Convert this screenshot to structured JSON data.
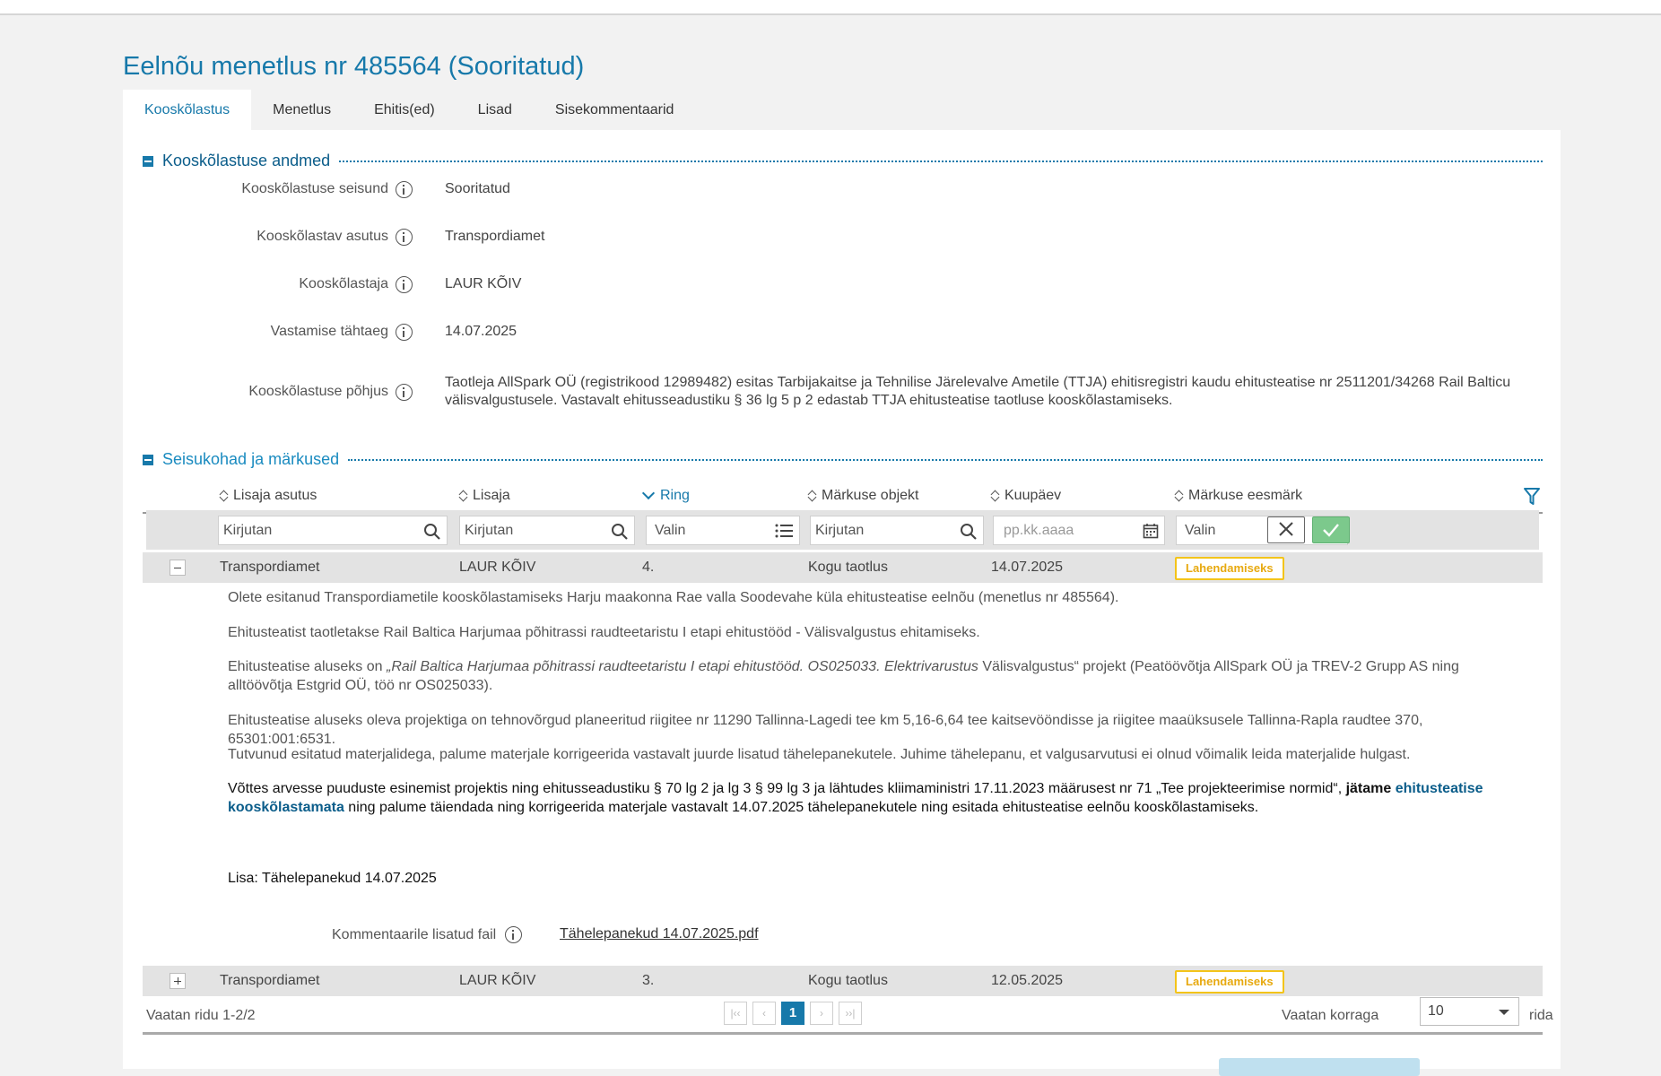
{
  "page": {
    "title": "Eelnõu menetlus nr 485564 (Sooritatud)"
  },
  "tabs": [
    {
      "label": "Kooskõlastus"
    },
    {
      "label": "Menetlus"
    },
    {
      "label": "Ehitis(ed)"
    },
    {
      "label": "Lisad"
    },
    {
      "label": "Sisekommentaarid"
    }
  ],
  "approval_section": {
    "title": "Kooskõlastuse andmed",
    "fields": [
      {
        "label": "Kooskõlastuse seisund",
        "value": "Sooritatud"
      },
      {
        "label": "Kooskõlastav asutus",
        "value": "Transpordiamet"
      },
      {
        "label": "Kooskõlastaja",
        "value": "LAUR KÕIV"
      },
      {
        "label": "Vastamise tähtaeg",
        "value": "14.07.2025"
      },
      {
        "label": "Kooskõlastuse põhjus",
        "value": "Taotleja AllSpark OÜ (registrikood 12989482) esitas Tarbijakaitse ja Tehnilise Järelevalve Ametile (TTJA) ehitisregistri kaudu ehitusteatise nr 2511201/34268 Rail Balticu välisvalgustusele. Vastavalt ehitusseadustiku § 36 lg 5 p 2 edastab TTJA ehitusteatise taotluse kooskõlastamiseks."
      }
    ]
  },
  "remarks_section": {
    "title": "Seisukohad ja märkused",
    "columns": [
      {
        "label": "Lisaja asutus"
      },
      {
        "label": "Lisaja"
      },
      {
        "label": "Ring"
      },
      {
        "label": "Märkuse objekt"
      },
      {
        "label": "Kuupäev"
      },
      {
        "label": "Märkuse eesmärk"
      }
    ],
    "filters": {
      "agency_placeholder": "Kirjutan",
      "author_placeholder": "Kirjutan",
      "round_placeholder": "Valin",
      "object_placeholder": "Kirjutan",
      "date_placeholder": "pp.kk.aaaa",
      "purpose_placeholder": "Valin"
    },
    "rows": [
      {
        "agency": "Transpordiamet",
        "author": "LAUR KÕIV",
        "round": "4.",
        "object": "Kogu taotlus",
        "date": "14.07.2025",
        "purpose": "Lahendamiseks"
      },
      {
        "agency": "Transpordiamet",
        "author": "LAUR KÕIV",
        "round": "3.",
        "object": "Kogu taotlus",
        "date": "12.05.2025",
        "purpose": "Lahendamiseks"
      }
    ],
    "detail": {
      "p1": "Olete esitanud Transpordiametile kooskõlastamiseks Harju maakonna Rae valla Soodevahe küla ehitusteatise eelnõu (menetlus nr 485564).",
      "p2": "Ehitusteatist taotletakse Rail Baltica Harjumaa põhitrassi raudteetaristu I etapi ehitustööd - Välisvalgustus ehitamiseks.",
      "p3_a": "Ehitusteatise aluseks on ",
      "p3_italic": "„Rail Baltica Harjumaa põhitrassi raudteetaristu I etapi ehitustööd. OS025033. Elektrivarustus",
      "p3_b": " Välisvalgustus“ projekt (Peatöövõtja AllSpark OÜ ja TREV-2 Grupp AS ning alltöövõtja Estgrid OÜ, töö nr OS025033).",
      "p4": "Ehitusteatise aluseks oleva projektiga on tehnovõrgud planeeritud riigitee nr 11290  Tallinna-Lagedi tee km 5,16-6,64 tee kaitsevööndisse ja riigitee maaüksusele Tallinna-Rapla raudtee 370, 65301:001:6531.",
      "p5": "Tutvunud esitatud materjalidega, palume materjale korrigeerida vastavalt juurde lisatud tähelepanekutele. Juhime tähelepanu, et valgusarvutusi ei olnud võimalik leida materjalide hulgast.",
      "p6_a": "Võttes arvesse puuduste esinemist projektis ning ehitusseadustiku § 70 lg 2 ja lg 3 § 99 lg 3 ja lähtudes kliimaministri 17.11.2023 määrusest nr 71 „Tee projekteerimise normid“, ",
      "p6_bold": "jätame",
      "p6_space": " ",
      "p6_blue": "ehitusteatise kooskõlastamata",
      "p6_b": " ning palume täiendada ning korrigeerida materjale vastavalt 14.07.2025 tähelepanekutele ning esitada ehitusteatise eelnõu kooskõlastamiseks.",
      "p7": "Lisa: Tähelepanekud 14.07.2025",
      "attachment_label": "Kommentaarile lisatud fail",
      "attachment_file": "Tähelepanekud 14.07.2025.pdf"
    },
    "footer": {
      "rows_info": "Vaatan ridu 1-2/2",
      "pages": [
        {
          "label": "|‹‹"
        },
        {
          "label": "‹"
        },
        {
          "label": "1"
        },
        {
          "label": "›"
        },
        {
          "label": "››|"
        }
      ],
      "per_page_label": "Vaatan korraga",
      "per_page_value": "10",
      "per_page_suffix": "rida"
    }
  }
}
